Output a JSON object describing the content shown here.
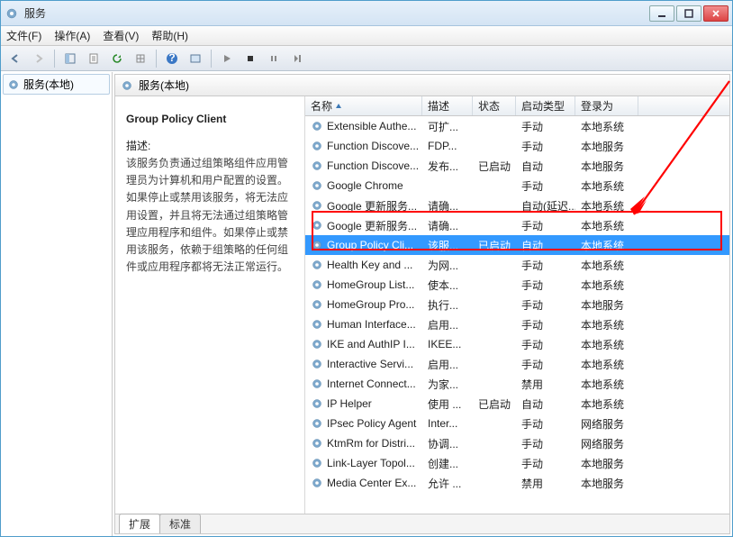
{
  "window": {
    "title": "服务"
  },
  "menu": {
    "file": "文件(F)",
    "action": "操作(A)",
    "view": "查看(V)",
    "help": "帮助(H)"
  },
  "tree": {
    "root": "服务(本地)"
  },
  "detailHeader": "服务(本地)",
  "selectedService": {
    "name": "Group Policy Client",
    "descLabel": "描述:",
    "description": "该服务负责通过组策略组件应用管理员为计算机和用户配置的设置。如果停止或禁用该服务，将无法应用设置，并且将无法通过组策略管理应用程序和组件。如果停止或禁用该服务，依赖于组策略的任何组件或应用程序都将无法正常运行。"
  },
  "columns": {
    "name": "名称",
    "desc": "描述",
    "status": "状态",
    "start": "启动类型",
    "logon": "登录为"
  },
  "services": [
    {
      "name": "Extensible Authe...",
      "desc": "可扩...",
      "status": "",
      "start": "手动",
      "logon": "本地系统"
    },
    {
      "name": "Function Discove...",
      "desc": "FDP...",
      "status": "",
      "start": "手动",
      "logon": "本地服务"
    },
    {
      "name": "Function Discove...",
      "desc": "发布...",
      "status": "已启动",
      "start": "自动",
      "logon": "本地服务"
    },
    {
      "name": "Google Chrome",
      "desc": "",
      "status": "",
      "start": "手动",
      "logon": "本地系统"
    },
    {
      "name": "Google 更新服务...",
      "desc": "请确...",
      "status": "",
      "start": "自动(延迟...",
      "logon": "本地系统"
    },
    {
      "name": "Google 更新服务...",
      "desc": "请确...",
      "status": "",
      "start": "手动",
      "logon": "本地系统"
    },
    {
      "name": "Group Policy Cli...",
      "desc": "该服...",
      "status": "已启动",
      "start": "自动",
      "logon": "本地系统",
      "selected": true
    },
    {
      "name": "Health Key and ...",
      "desc": "为网...",
      "status": "",
      "start": "手动",
      "logon": "本地系统"
    },
    {
      "name": "HomeGroup List...",
      "desc": "使本...",
      "status": "",
      "start": "手动",
      "logon": "本地系统"
    },
    {
      "name": "HomeGroup Pro...",
      "desc": "执行...",
      "status": "",
      "start": "手动",
      "logon": "本地服务"
    },
    {
      "name": "Human Interface...",
      "desc": "启用...",
      "status": "",
      "start": "手动",
      "logon": "本地系统"
    },
    {
      "name": "IKE and AuthIP I...",
      "desc": "IKEE...",
      "status": "",
      "start": "手动",
      "logon": "本地系统"
    },
    {
      "name": "Interactive Servi...",
      "desc": "启用...",
      "status": "",
      "start": "手动",
      "logon": "本地系统"
    },
    {
      "name": "Internet Connect...",
      "desc": "为家...",
      "status": "",
      "start": "禁用",
      "logon": "本地系统"
    },
    {
      "name": "IP Helper",
      "desc": "使用 ...",
      "status": "已启动",
      "start": "自动",
      "logon": "本地系统"
    },
    {
      "name": "IPsec Policy Agent",
      "desc": "Inter...",
      "status": "",
      "start": "手动",
      "logon": "网络服务"
    },
    {
      "name": "KtmRm for Distri...",
      "desc": "协调...",
      "status": "",
      "start": "手动",
      "logon": "网络服务"
    },
    {
      "name": "Link-Layer Topol...",
      "desc": "创建...",
      "status": "",
      "start": "手动",
      "logon": "本地服务"
    },
    {
      "name": "Media Center Ex...",
      "desc": "允许 ...",
      "status": "",
      "start": "禁用",
      "logon": "本地服务"
    }
  ],
  "tabs": {
    "extended": "扩展",
    "standard": "标准"
  }
}
